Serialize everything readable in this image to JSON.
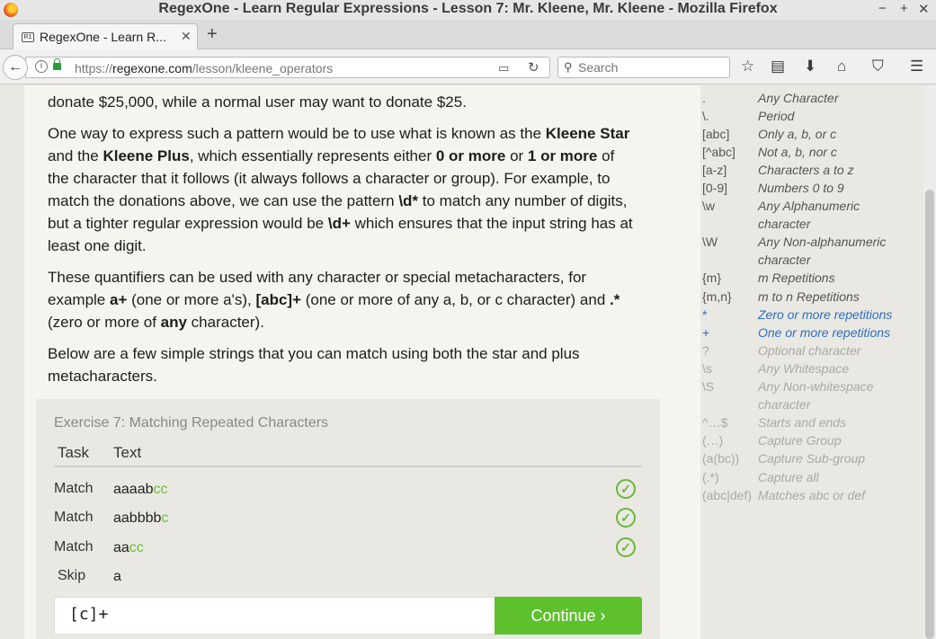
{
  "window": {
    "title": "RegexOne - Learn Regular Expressions - Lesson 7: Mr. Kleene, Mr. Kleene - Mozilla Firefox",
    "minimize": "−",
    "maximize": "+",
    "close": "✕"
  },
  "tab": {
    "label": "RegexOne - Learn R...",
    "close": "✕",
    "favicon": "R1"
  },
  "new_tab": "+",
  "nav": {
    "back": "←",
    "url_prefix": "https://",
    "url_host": "regexone.com",
    "url_path": "/lesson/kleene_operators",
    "search_placeholder": "Search",
    "icons": [
      "star-icon",
      "reading-list-icon",
      "download-icon",
      "home-icon",
      "pocket-icon",
      "menu-icon"
    ]
  },
  "lesson": {
    "p0": "donate $25,000, while a normal user may want to donate $25.",
    "p1": {
      "a": "One way to express such a pattern would be to use what is known as the ",
      "b": "Kleene Star",
      "c": " and the ",
      "d": "Kleene Plus",
      "e": ", which essentially represents either ",
      "f": "0 or more",
      "g": " or ",
      "h": "1 or more",
      "i": " of the character that it follows (it always follows a character or group). For example, to match the donations above, we can use the pattern ",
      "j": "\\d*",
      "k": " to match any number of digits, but a tighter regular expression would be ",
      "l": "\\d+",
      "m": " which ensures that the input string has at least one digit."
    },
    "p2": {
      "a": "These quantifiers can be used with any character or special metacharacters, for example ",
      "b": "a+",
      "c": " (one or more a's), ",
      "d": "[abc]+",
      "e": " (one or more of any a, b, or c character) and ",
      "f": ".*",
      "g": " (zero or more of ",
      "h": "any",
      "i": " character)."
    },
    "p3": "Below are a few simple strings that you can match using both the star and plus metacharacters."
  },
  "exercise": {
    "title": "Exercise 7: Matching Repeated Characters",
    "col_task": "Task",
    "col_text": "Text",
    "rows": [
      {
        "task": "Match",
        "plain": "aaaab",
        "hl": "cc",
        "check": "✓"
      },
      {
        "task": "Match",
        "plain": "aabbbb",
        "hl": "c",
        "check": "✓"
      },
      {
        "task": "Match",
        "plain": "aa",
        "hl": "cc",
        "check": "✓"
      },
      {
        "task": "Skip",
        "plain": "a",
        "hl": ""
      }
    ],
    "answer": "[c]+",
    "continue": "Continue ›"
  },
  "reference": [
    {
      "sym": ".",
      "desc": "Any Character"
    },
    {
      "sym": "\\.",
      "desc": "Period"
    },
    {
      "sym": "[abc]",
      "desc": "Only a, b, or c"
    },
    {
      "sym": "[^abc]",
      "desc": "Not a, b, nor c"
    },
    {
      "sym": "[a-z]",
      "desc": "Characters a to z"
    },
    {
      "sym": "[0-9]",
      "desc": "Numbers 0 to 9"
    },
    {
      "sym": "\\w",
      "desc": "Any Alphanumeric character"
    },
    {
      "sym": "\\W",
      "desc": "Any Non-alphanumeric character"
    },
    {
      "sym": "{m}",
      "desc": "m Repetitions"
    },
    {
      "sym": "{m,n}",
      "desc": "m to n Repetitions"
    },
    {
      "sym": "*",
      "desc": "Zero or more repetitions"
    },
    {
      "sym": "+",
      "desc": "One or more repetitions"
    },
    {
      "sym": "?",
      "desc": "Optional character"
    },
    {
      "sym": "\\s",
      "desc": "Any Whitespace"
    },
    {
      "sym": "\\S",
      "desc": "Any Non-whitespace character"
    },
    {
      "sym": "^…$",
      "desc": "Starts and ends"
    },
    {
      "sym": "(…)",
      "desc": "Capture Group"
    },
    {
      "sym": "(a(bc))",
      "desc": "Capture Sub-group"
    },
    {
      "sym": "(.*)",
      "desc": "Capture all"
    },
    {
      "sym": "(abc|def)",
      "desc": "Matches abc or def"
    }
  ],
  "colors": {
    "accent_green": "#5ec02d",
    "link_blue": "#2f6fbd",
    "muted": "#a9a9a5"
  }
}
